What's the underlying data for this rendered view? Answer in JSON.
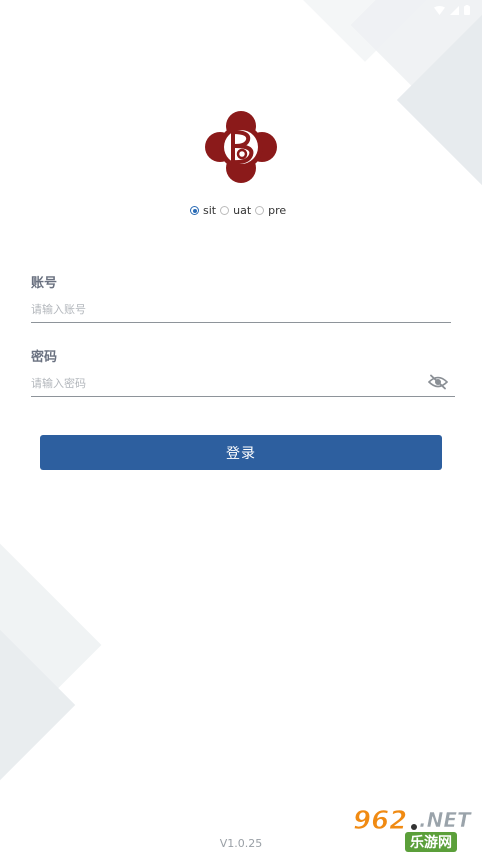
{
  "env": {
    "options": [
      {
        "label": "sit",
        "checked": true
      },
      {
        "label": "uat",
        "checked": false
      },
      {
        "label": "pre",
        "checked": false
      }
    ]
  },
  "form": {
    "account": {
      "label": "账号",
      "placeholder": "请输入账号",
      "value": ""
    },
    "password": {
      "label": "密码",
      "placeholder": "请输入密码",
      "value": ""
    }
  },
  "login_button": {
    "label": "登录"
  },
  "version": "V1.0.25",
  "watermark": {
    "number": "962",
    "net": ".NET",
    "sub": "乐游网"
  },
  "icons": {
    "status": [
      "wifi-icon",
      "signal-icon",
      "battery-icon"
    ],
    "logo": "b-cloud-logo-icon",
    "password_toggle": "eye-off-icon"
  },
  "colors": {
    "primary": "#2d5f9f",
    "radio_checked": "#2a6bb5",
    "logo": "#8b1a1a",
    "label": "#6a7180",
    "placeholder": "#b3b7bc",
    "underline": "#8e949a",
    "version": "#9aa0a6"
  }
}
